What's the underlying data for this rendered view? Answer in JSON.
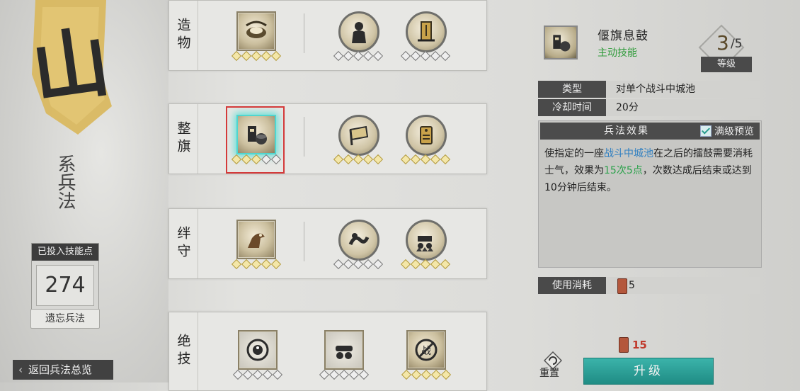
{
  "left_panel": {
    "banner_glyph": "山",
    "vertical_title": "系兵法",
    "points_label": "已投入技能点",
    "points_value": "274",
    "forget_button": "遗忘兵法",
    "back_button": "返回兵法总览"
  },
  "rows": [
    {
      "label": "造物",
      "skills": [
        {
          "shape": "square",
          "icon": "craft-icon",
          "level_filled": 0
        },
        {
          "shape": "circle",
          "icon": "soldier-icon",
          "level_filled": 0
        },
        {
          "shape": "circle",
          "icon": "tablet-icon",
          "level_filled": 0
        }
      ]
    },
    {
      "label": "整旗",
      "skills": [
        {
          "shape": "square",
          "icon": "banner-drum-icon",
          "level_filled": 0,
          "selected": true
        },
        {
          "shape": "circle",
          "icon": "flag-icon",
          "level_filled": 0
        },
        {
          "shape": "circle",
          "icon": "tag-icon",
          "level_filled": 0
        }
      ]
    },
    {
      "label": "绊守",
      "skills": [
        {
          "shape": "square",
          "icon": "horse-icon",
          "level_filled": 0
        },
        {
          "shape": "circle",
          "icon": "serpent-icon",
          "level_filled": 0
        },
        {
          "shape": "circle",
          "icon": "cannon-troop-icon",
          "level_filled": 0
        }
      ]
    },
    {
      "label": "绝技",
      "skills": [
        {
          "shape": "square",
          "icon": "bagua-icon",
          "level_filled": 0
        },
        {
          "shape": "square",
          "icon": "cannon-icon",
          "level_filled": 0
        },
        {
          "shape": "square",
          "icon": "no-battle-icon",
          "level_filled": 0
        }
      ]
    }
  ],
  "detail": {
    "skill_name": "偃旗息鼓",
    "skill_type": "主动技能",
    "level_current": "3",
    "level_max": "/5",
    "level_label": "等级",
    "type_key": "类型",
    "type_value": "对单个战斗中城池",
    "cooldown_key": "冷却时间",
    "cooldown_value": "20分",
    "effect_title": "兵法效果",
    "max_preview_label": "满级预览",
    "max_preview_checked": true,
    "effect_parts": {
      "p1": "使指定的一座",
      "p2": "战斗中城池",
      "p3": "在之后的擂鼓需要消耗士气，效果为",
      "p4": "15次5点",
      "p5": "，次数达成后结束或达到10分钟后结束。"
    },
    "cost_key": "使用消耗",
    "cost_value": "5",
    "upgrade_cost": "15",
    "reset_label": "重置",
    "upgrade_button": "升级"
  },
  "colors": {
    "accent_teal": "#2aa39a",
    "selection_red": "#d43a3a",
    "glow_cyan": "#4fd6d0",
    "skill_type_green": "#2f9b3a",
    "highlight_blue": "#2f7fc1",
    "highlight_green": "#2aa14a"
  }
}
